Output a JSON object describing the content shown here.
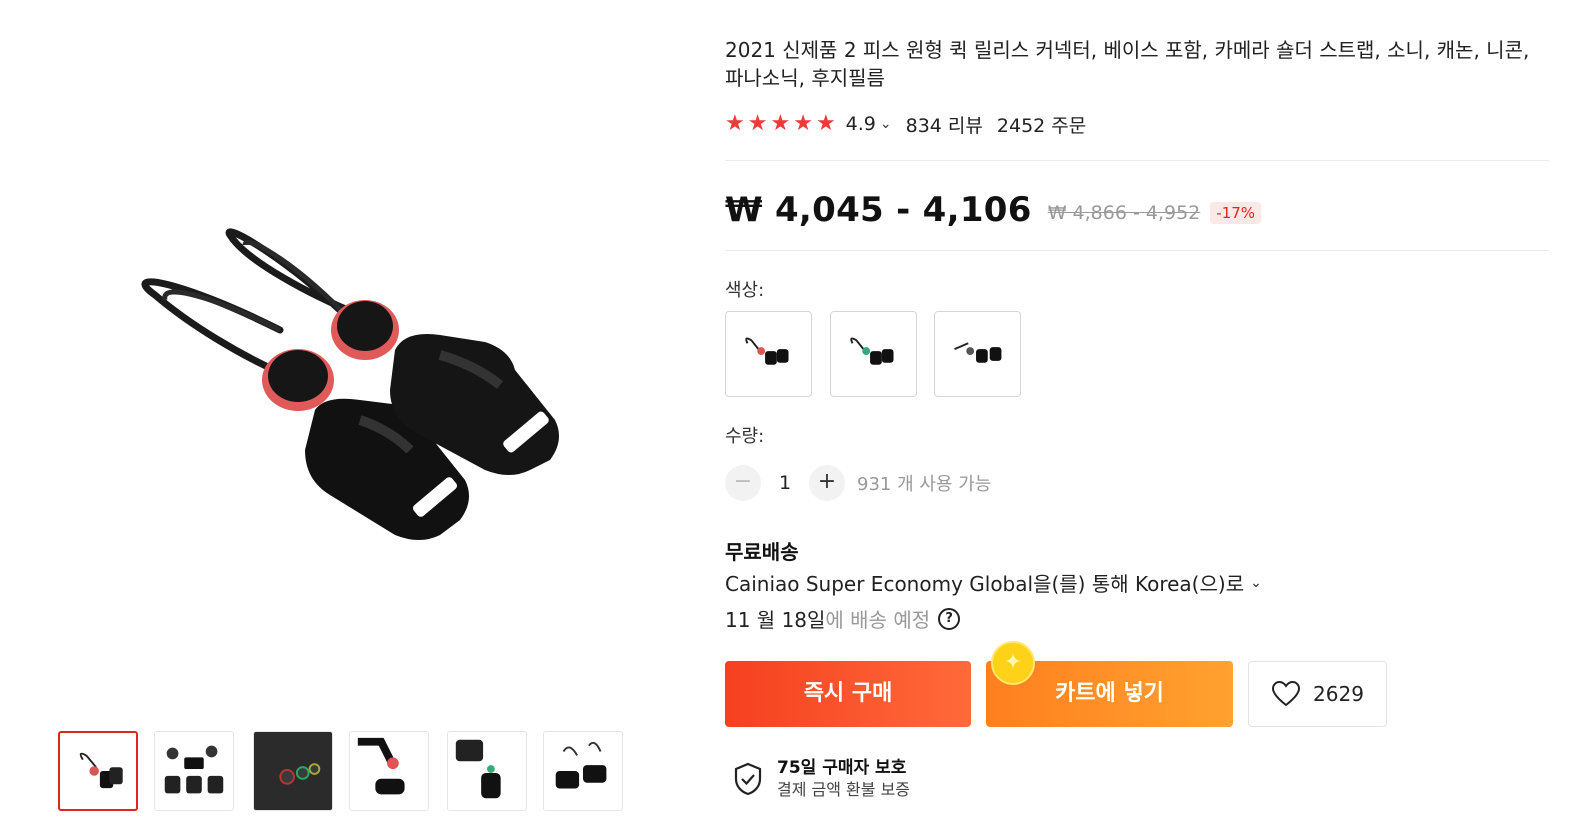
{
  "product": {
    "title": "2021 신제품 2 피스 원형 퀵 릴리스 커넥터, 베이스 포함, 카메라 숄더 스트랩, 소니, 캐논, 니콘, 파나소닉, 후지필름",
    "rating": {
      "stars": 5,
      "value": "4.9",
      "reviews": "834 리뷰",
      "orders": "2452 주문"
    },
    "price": {
      "current": "₩ 4,045 - 4,106",
      "original": "₩ 4,866 - 4,952",
      "discount": "-17%"
    },
    "color_label": "색상:",
    "quantity": {
      "label": "수량:",
      "minus": "−",
      "value": "1",
      "plus": "+",
      "available": "931 개 사용 가능"
    },
    "shipping": {
      "title": "무료배송",
      "method": "Cainiao Super Economy Global을(를) 통해 Korea(으)로",
      "eta_date": "11 월 18일",
      "eta_suffix": "에 배송 예정",
      "help": "?"
    },
    "actions": {
      "buy_now": "즉시 구매",
      "add_to_cart": "카트에 넣기",
      "wishlist_count": "2629"
    },
    "protection": {
      "title": "75일 구매자 보호",
      "subtitle": "결제 금액 환불 보증"
    }
  },
  "gallery": {
    "thumbnails": [
      "thumb-1",
      "thumb-2",
      "thumb-3",
      "thumb-4",
      "thumb-5",
      "thumb-6"
    ],
    "active_index": 0
  },
  "colors": {
    "accent_red": "#e1251b",
    "star_red": "#f03a3a",
    "buy_orange": "#f5401f",
    "cart_orange": "#ffa22f"
  }
}
